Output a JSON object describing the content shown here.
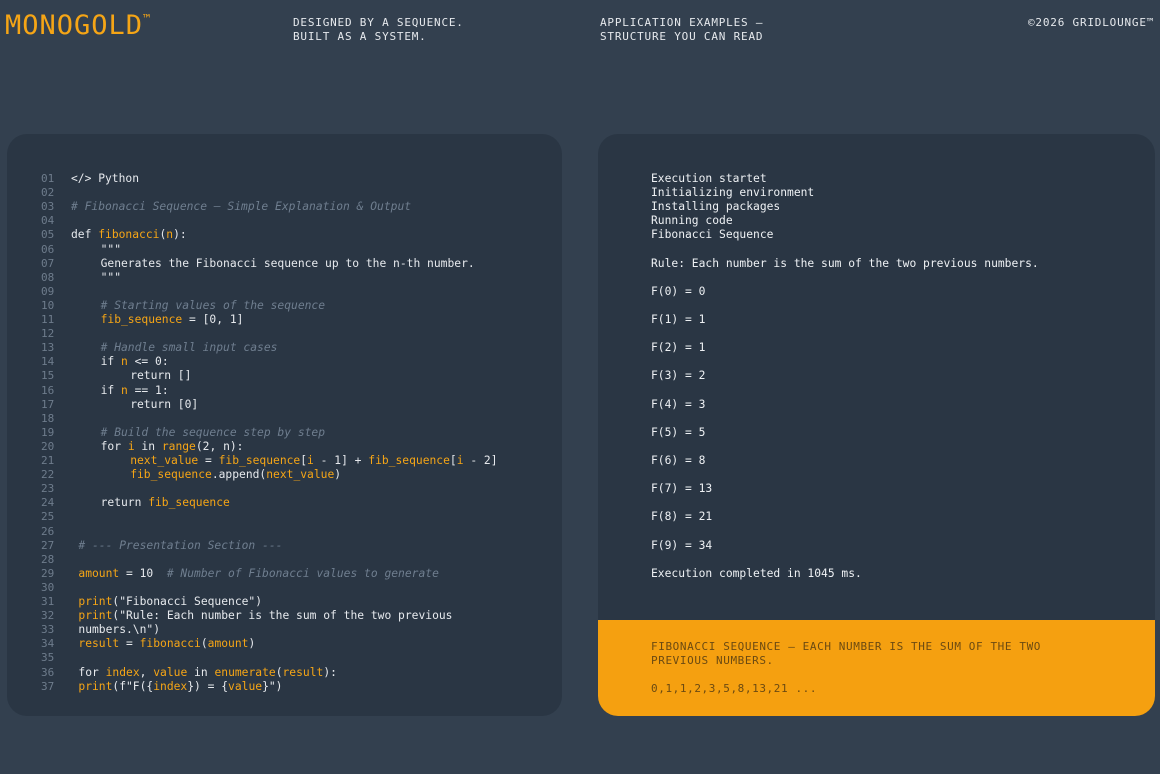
{
  "header": {
    "logo": "MONOGOLD",
    "logo_mark": "™",
    "tagline_1": "DESIGNED BY A SEQUENCE.\nBUILT AS A SYSTEM.",
    "tagline_2": "APPLICATION EXAMPLES –\nSTRUCTURE YOU CAN READ",
    "copyright": "©2026 GRIDLOUNGE™"
  },
  "code_panel": {
    "line_numbers": [
      "01",
      "02",
      "03",
      "04",
      "05",
      "06",
      "07",
      "08",
      "09",
      "10",
      "11",
      "12",
      "13",
      "14",
      "15",
      "16",
      "17",
      "18",
      "19",
      "20",
      "21",
      "22",
      "23",
      "24",
      "25",
      "26",
      "27",
      "28",
      "29",
      "30",
      "31",
      "32",
      "33",
      "34",
      "35",
      "36",
      "37"
    ],
    "lines": [
      {
        "indent": 0,
        "parts": [
          {
            "t": "</> Python",
            "k": ""
          }
        ]
      },
      {
        "indent": 0,
        "parts": []
      },
      {
        "indent": 0,
        "parts": [
          {
            "t": "# Fibonacci Sequence – Simple Explanation & Output",
            "k": "c"
          }
        ]
      },
      {
        "indent": 0,
        "parts": []
      },
      {
        "indent": 0,
        "parts": [
          {
            "t": "def ",
            "k": ""
          },
          {
            "t": "fibonacci",
            "k": "o"
          },
          {
            "t": "(",
            "k": ""
          },
          {
            "t": "n",
            "k": "o"
          },
          {
            "t": "):",
            "k": ""
          }
        ]
      },
      {
        "indent": 4,
        "parts": [
          {
            "t": "\"\"\"",
            "k": ""
          }
        ]
      },
      {
        "indent": 4,
        "parts": [
          {
            "t": "Generates the Fibonacci sequence up to the n-th number.",
            "k": ""
          }
        ]
      },
      {
        "indent": 4,
        "parts": [
          {
            "t": "\"\"\"",
            "k": ""
          }
        ]
      },
      {
        "indent": 0,
        "parts": []
      },
      {
        "indent": 4,
        "parts": [
          {
            "t": "# Starting values of the sequence",
            "k": "c"
          }
        ]
      },
      {
        "indent": 4,
        "parts": [
          {
            "t": "fib_sequence",
            "k": "o"
          },
          {
            "t": " = [0, 1]",
            "k": ""
          }
        ]
      },
      {
        "indent": 0,
        "parts": []
      },
      {
        "indent": 4,
        "parts": [
          {
            "t": "# Handle small input cases",
            "k": "c"
          }
        ]
      },
      {
        "indent": 4,
        "parts": [
          {
            "t": "if ",
            "k": ""
          },
          {
            "t": "n",
            "k": "o"
          },
          {
            "t": " <= 0:",
            "k": ""
          }
        ]
      },
      {
        "indent": 8,
        "parts": [
          {
            "t": "return []",
            "k": ""
          }
        ]
      },
      {
        "indent": 4,
        "parts": [
          {
            "t": "if ",
            "k": ""
          },
          {
            "t": "n",
            "k": "o"
          },
          {
            "t": " == 1:",
            "k": ""
          }
        ]
      },
      {
        "indent": 8,
        "parts": [
          {
            "t": "return [0]",
            "k": ""
          }
        ]
      },
      {
        "indent": 0,
        "parts": []
      },
      {
        "indent": 4,
        "parts": [
          {
            "t": "# Build the sequence step by step",
            "k": "c"
          }
        ]
      },
      {
        "indent": 4,
        "parts": [
          {
            "t": "for ",
            "k": ""
          },
          {
            "t": "i",
            "k": "o"
          },
          {
            "t": " in ",
            "k": ""
          },
          {
            "t": "range",
            "k": "o"
          },
          {
            "t": "(2, n):",
            "k": ""
          }
        ]
      },
      {
        "indent": 8,
        "parts": [
          {
            "t": "next_value",
            "k": "o"
          },
          {
            "t": " = ",
            "k": ""
          },
          {
            "t": "fib_sequence",
            "k": "o"
          },
          {
            "t": "[",
            "k": ""
          },
          {
            "t": "i",
            "k": "o"
          },
          {
            "t": " - 1] + ",
            "k": ""
          },
          {
            "t": "fib_sequence",
            "k": "o"
          },
          {
            "t": "[",
            "k": ""
          },
          {
            "t": "i",
            "k": "o"
          },
          {
            "t": " - 2]",
            "k": ""
          }
        ]
      },
      {
        "indent": 8,
        "parts": [
          {
            "t": "fib_sequence",
            "k": "o"
          },
          {
            "t": ".append(",
            "k": ""
          },
          {
            "t": "next_value",
            "k": "o"
          },
          {
            "t": ")",
            "k": ""
          }
        ]
      },
      {
        "indent": 0,
        "parts": []
      },
      {
        "indent": 4,
        "parts": [
          {
            "t": "return ",
            "k": ""
          },
          {
            "t": "fib_sequence",
            "k": "o"
          }
        ]
      },
      {
        "indent": 0,
        "parts": []
      },
      {
        "indent": 0,
        "parts": []
      },
      {
        "indent": 1,
        "parts": [
          {
            "t": "# --- Presentation Section ---",
            "k": "c"
          }
        ]
      },
      {
        "indent": 0,
        "parts": []
      },
      {
        "indent": 1,
        "parts": [
          {
            "t": "amount",
            "k": "o"
          },
          {
            "t": " = 10  ",
            "k": ""
          },
          {
            "t": "# Number of Fibonacci values to generate",
            "k": "c"
          }
        ]
      },
      {
        "indent": 0,
        "parts": []
      },
      {
        "indent": 1,
        "parts": [
          {
            "t": "print",
            "k": "o"
          },
          {
            "t": "(\"Fibonacci Sequence\")",
            "k": ""
          }
        ]
      },
      {
        "indent": 1,
        "parts": [
          {
            "t": "print",
            "k": "o"
          },
          {
            "t": "(\"Rule: Each number is the sum of the two previous",
            "k": ""
          }
        ]
      },
      {
        "indent": 1,
        "parts": [
          {
            "t": "numbers.\\n\")",
            "k": ""
          }
        ]
      },
      {
        "indent": 1,
        "parts": [
          {
            "t": "result",
            "k": "o"
          },
          {
            "t": " = ",
            "k": ""
          },
          {
            "t": "fibonacci",
            "k": "o"
          },
          {
            "t": "(",
            "k": ""
          },
          {
            "t": "amount",
            "k": "o"
          },
          {
            "t": ")",
            "k": ""
          }
        ]
      },
      {
        "indent": 0,
        "parts": []
      },
      {
        "indent": 1,
        "parts": [
          {
            "t": "for ",
            "k": ""
          },
          {
            "t": "index",
            "k": "o"
          },
          {
            "t": ", ",
            "k": ""
          },
          {
            "t": "value",
            "k": "o"
          },
          {
            "t": " in ",
            "k": ""
          },
          {
            "t": "enumerate",
            "k": "o"
          },
          {
            "t": "(",
            "k": ""
          },
          {
            "t": "result",
            "k": "o"
          },
          {
            "t": "):",
            "k": ""
          }
        ]
      },
      {
        "indent": 1,
        "parts": [
          {
            "t": "print",
            "k": "o"
          },
          {
            "t": "(f\"F({",
            "k": ""
          },
          {
            "t": "index",
            "k": "o"
          },
          {
            "t": "}) = {",
            "k": ""
          },
          {
            "t": "value",
            "k": "o"
          },
          {
            "t": "}\")",
            "k": ""
          }
        ]
      }
    ]
  },
  "output_panel": {
    "lines": [
      {
        "row": 0,
        "text": "Execution startet"
      },
      {
        "row": 1,
        "text": "Initializing environment"
      },
      {
        "row": 2,
        "text": "Installing packages"
      },
      {
        "row": 3,
        "text": "Running code"
      },
      {
        "row": 4,
        "text": "Fibonacci Sequence"
      },
      {
        "row": 6,
        "text": "Rule: Each number is the sum of the two previous numbers."
      },
      {
        "row": 8,
        "text": "F(0) = 0"
      },
      {
        "row": 10,
        "text": "F(1) = 1"
      },
      {
        "row": 12,
        "text": "F(2) = 1"
      },
      {
        "row": 14,
        "text": "F(3) = 2"
      },
      {
        "row": 16,
        "text": "F(4) = 3"
      },
      {
        "row": 18,
        "text": "F(5) = 5"
      },
      {
        "row": 20,
        "text": "F(6) = 8"
      },
      {
        "row": 22,
        "text": "F(7) = 13"
      },
      {
        "row": 24,
        "text": "F(8) = 21"
      },
      {
        "row": 26,
        "text": "F(9) = 34"
      },
      {
        "row": 28,
        "text": "Execution completed in 1045 ms."
      }
    ],
    "banner_text": "FIBONACCI SEQUENCE – EACH NUMBER IS THE SUM OF THE TWO PREVIOUS NUMBERS.",
    "banner_sequence": "0,1,1,2,3,5,8,13,21 ..."
  },
  "colors": {
    "background": "#33404f",
    "panel": "#2a3644",
    "accent": "#f5a516"
  }
}
